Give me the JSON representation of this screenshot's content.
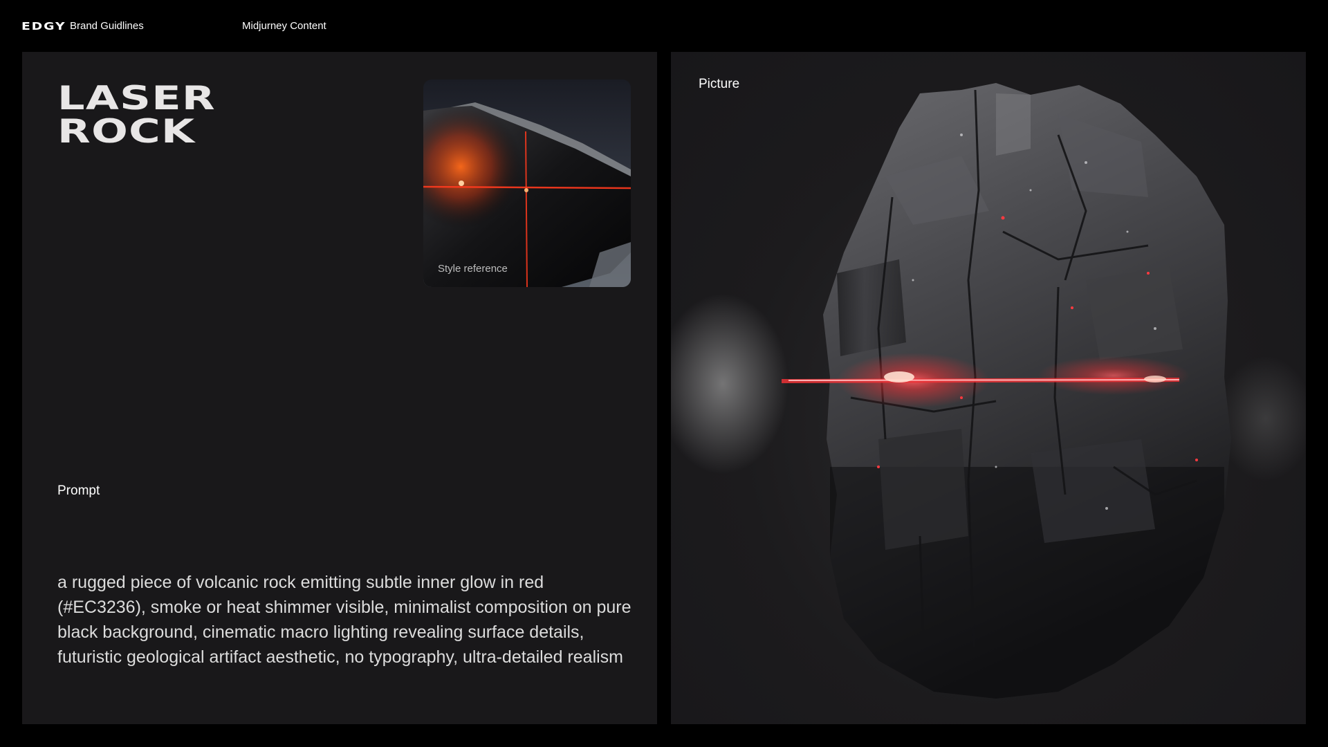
{
  "header": {
    "logo": "EDGY",
    "brand": "Brand Guidlines",
    "section": "Midjurney Content"
  },
  "left_panel": {
    "title_line1": "LASER",
    "title_line2": "ROCK",
    "style_reference_caption": "Style reference",
    "prompt_label": "Prompt",
    "prompt_text": "a rugged piece of volcanic rock emitting subtle inner glow in red (#EC3236), smoke or heat shimmer visible, minimalist composition on pure black background, cinematic macro lighting revealing surface details, futuristic geological artifact aesthetic, no typography, ultra-detailed realism"
  },
  "right_panel": {
    "label": "Picture"
  },
  "colors": {
    "background": "#000000",
    "panel": "#19181a",
    "accent_red": "#EC3236",
    "text_primary": "#ffffff",
    "text_secondary": "#dcdcdc"
  }
}
